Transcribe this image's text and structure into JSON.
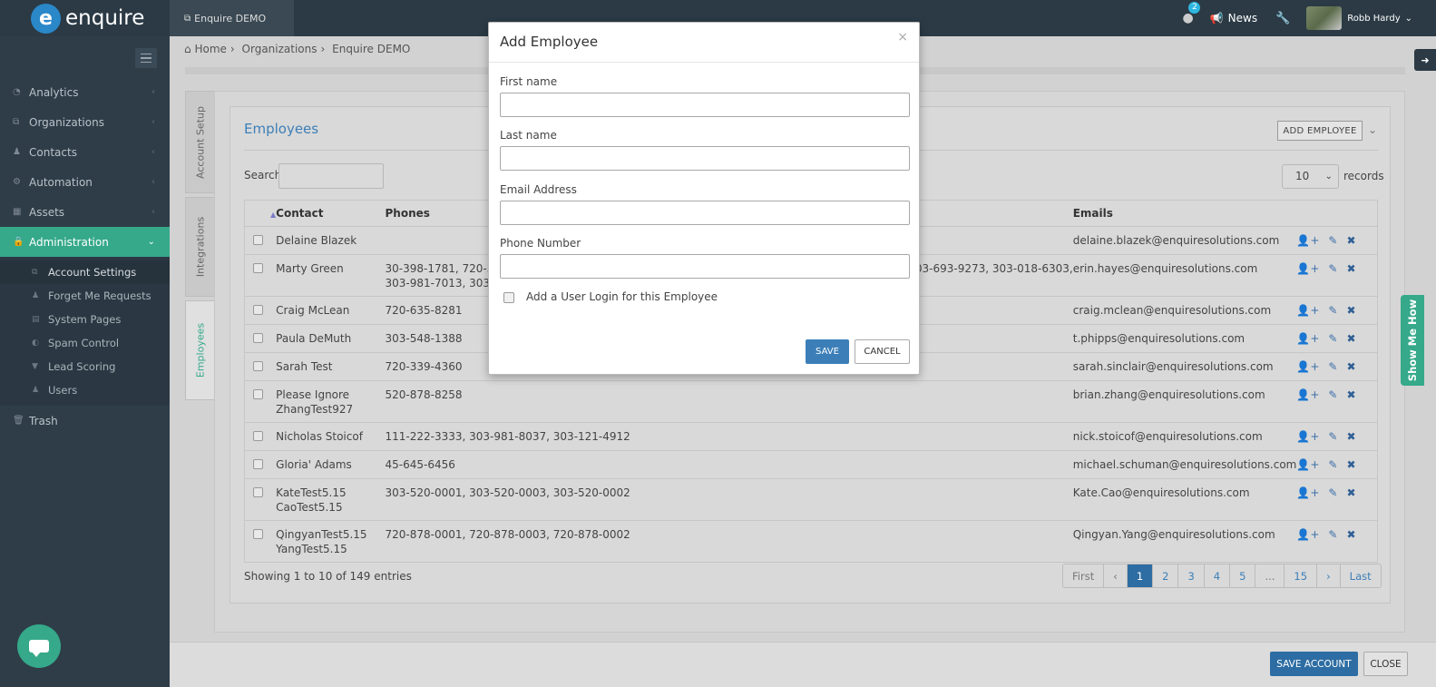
{
  "app": {
    "brand": "enquire",
    "org_tab": "Enquire DEMO"
  },
  "topbar": {
    "notif_count": "2",
    "news": "News",
    "user": "Robb Hardy"
  },
  "sidebar": {
    "items": [
      {
        "label": "Analytics",
        "icon": "chart-icon"
      },
      {
        "label": "Organizations",
        "icon": "sitemap-icon"
      },
      {
        "label": "Contacts",
        "icon": "users-icon"
      },
      {
        "label": "Automation",
        "icon": "cogs-icon"
      },
      {
        "label": "Assets",
        "icon": "grid-icon"
      },
      {
        "label": "Administration",
        "icon": "lock-icon"
      }
    ],
    "subitems": [
      {
        "label": "Account Settings"
      },
      {
        "label": "Forget Me Requests"
      },
      {
        "label": "System Pages"
      },
      {
        "label": "Spam Control"
      },
      {
        "label": "Lead Scoring"
      },
      {
        "label": "Users"
      }
    ],
    "trash": "Trash"
  },
  "breadcrumb": {
    "home": "Home",
    "orgs": "Organizations",
    "current": "Enquire DEMO"
  },
  "vtabs": {
    "account_setup": "Account Setup",
    "integrations": "Integrations",
    "employees": "Employees"
  },
  "panel": {
    "title": "Employees",
    "add_button": "ADD EMPLOYEE",
    "search_label": "Search:",
    "records_value": "10",
    "records_label": "records",
    "columns": {
      "contact": "Contact",
      "phones": "Phones",
      "emails": "Emails"
    },
    "rows": [
      {
        "contact": "Delaine Blazek",
        "phones": "",
        "email": "delaine.blazek@enquiresolutions.com"
      },
      {
        "contact": "Marty Green",
        "phones": "30-398-1781, 720-32",
        "phones2": "303-981-7013, 303-",
        "phones_right": "555, 303-693-9273, 303-018-6303,",
        "email": "erin.hayes@enquiresolutions.com"
      },
      {
        "contact": "Craig McLean",
        "phones": "720-635-8281",
        "email": "craig.mclean@enquiresolutions.com"
      },
      {
        "contact": "Paula DeMuth",
        "phones": "303-548-1388",
        "email": "t.phipps@enquiresolutions.com"
      },
      {
        "contact": "Sarah Test",
        "phones": "720-339-4360",
        "email": "sarah.sinclair@enquiresolutions.com"
      },
      {
        "contact": "Please Ignore",
        "contact2": "ZhangTest927",
        "phones": "520-878-8258",
        "email": "brian.zhang@enquiresolutions.com"
      },
      {
        "contact": "Nicholas Stoicof",
        "phones": "111-222-3333, 303-981-8037, 303-121-4912",
        "email": "nick.stoicof@enquiresolutions.com"
      },
      {
        "contact": "Gloria' Adams",
        "phones": "45-645-6456",
        "email": "michael.schuman@enquiresolutions.com"
      },
      {
        "contact": "KateTest5.15",
        "contact2": "CaoTest5.15",
        "phones": "303-520-0001, 303-520-0003, 303-520-0002",
        "email": "Kate.Cao@enquiresolutions.com"
      },
      {
        "contact": "QingyanTest5.15",
        "contact2": "YangTest5.15",
        "phones": "720-878-0001, 720-878-0003, 720-878-0002",
        "email": "Qingyan.Yang@enquiresolutions.com"
      }
    ],
    "showing": "Showing 1 to 10 of 149 entries",
    "pager": [
      "First",
      "‹",
      "1",
      "2",
      "3",
      "4",
      "5",
      "...",
      "15",
      "›",
      "Last"
    ]
  },
  "footer": {
    "save": "SAVE ACCOUNT",
    "close": "CLOSE"
  },
  "show_me": "Show Me How",
  "modal": {
    "title": "Add Employee",
    "first_name": "First name",
    "last_name": "Last name",
    "email": "Email Address",
    "phone": "Phone Number",
    "login": "Add a User Login for this Employee",
    "save": "SAVE",
    "cancel": "CANCEL"
  }
}
